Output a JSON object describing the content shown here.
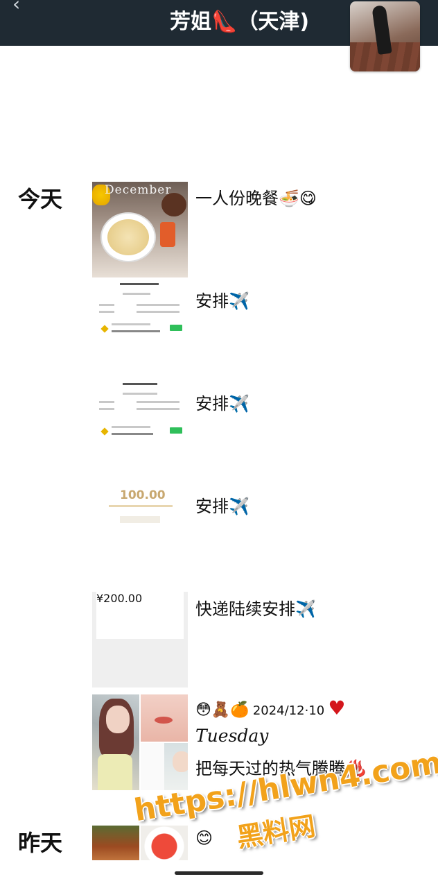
{
  "header": {
    "title": "芳姐👠（天津)",
    "back_icon": "chevron-left-icon",
    "avatar": "profile-avatar"
  },
  "days": {
    "today": "今天",
    "yesterday": "昨天"
  },
  "posts": [
    {
      "caption": "一人份晚餐🍜😋",
      "thumb_text": "December"
    },
    {
      "caption": "安排✈️"
    },
    {
      "caption": "安排✈️"
    },
    {
      "caption": "安排✈️",
      "thumb_amount": "100.00"
    },
    {
      "caption": "快递陆续安排✈️",
      "thumb_amount": "¥200.00"
    },
    {
      "diary_emoji": "😳🧸🍊",
      "diary_date": "2024/12·10",
      "heart": "♥",
      "day_name": "Tuesday",
      "caption": "把每天过的热气腾腾♨️"
    },
    {
      "caption": "😊"
    }
  ],
  "watermark": {
    "url": "https://hlwn4.com",
    "name": "黑料网"
  },
  "colors": {
    "header_bg": "#1f2a33",
    "accent_green": "#2fbf5a",
    "watermark": "#f2a21b"
  }
}
